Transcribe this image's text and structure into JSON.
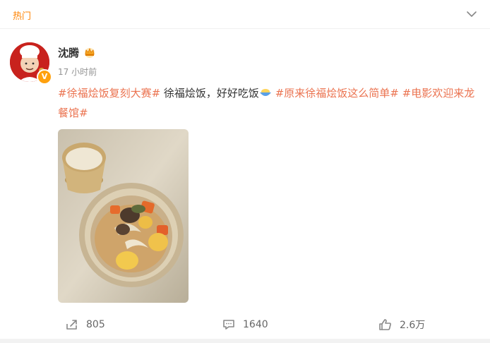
{
  "header": {
    "tab_label": "热门"
  },
  "post": {
    "author": "沈腾",
    "time": "17 小时前",
    "content": {
      "tag1": "#徐福烩饭复刻大赛#",
      "text1": " 徐福烩饭，好好吃饭",
      "tag2": "#原来徐福烩饭这么简单#",
      "tag3": "#电影欢迎来龙餐馆#"
    },
    "image_alt": "rice bowl photo",
    "verified_badge": "V"
  },
  "actions": {
    "repost": "805",
    "comment": "1640",
    "like": "2.6万"
  },
  "colors": {
    "accent": "#ff8200",
    "tag": "#eb7350",
    "badge": "#ffa10e"
  },
  "icons": [
    "chevron-down-icon",
    "crown-icon",
    "bowl-emoji-icon",
    "repost-icon",
    "comment-icon",
    "like-icon"
  ]
}
